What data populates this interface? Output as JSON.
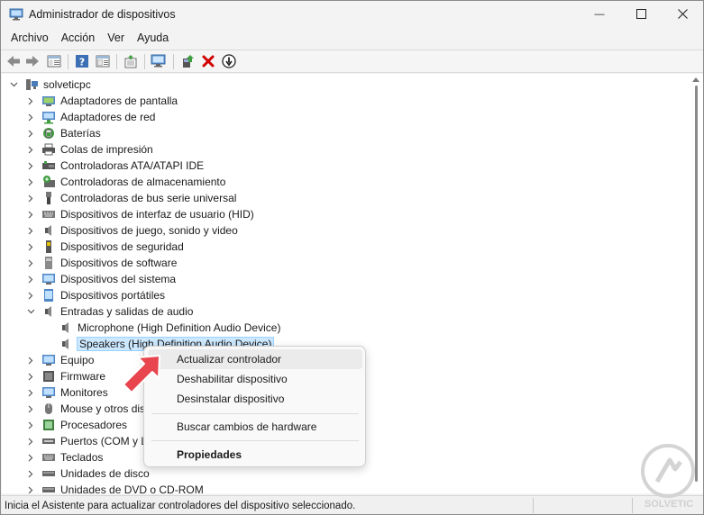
{
  "window": {
    "title": "Administrador de dispositivos",
    "minimize_glyph": "—",
    "maximize_glyph": "☐",
    "close_glyph": "✕"
  },
  "menu": [
    "Archivo",
    "Acción",
    "Ver",
    "Ayuda"
  ],
  "toolbar": {
    "buttons": [
      "back-arrow-icon",
      "forward-arrow-icon",
      "show-hide-console-tree-icon",
      "help-icon",
      "properties-icon",
      "export-list-icon",
      "monitor-scan-icon",
      "update-driver-icon",
      "uninstall-x-icon",
      "disable-device-icon"
    ]
  },
  "tree": {
    "root": "solveticpc",
    "categories": [
      "Adaptadores de pantalla",
      "Adaptadores de red",
      "Baterías",
      "Colas de impresión",
      "Controladoras ATA/ATAPI IDE",
      "Controladoras de almacenamiento",
      "Controladoras de bus serie universal",
      "Dispositivos de interfaz de usuario (HID)",
      "Dispositivos de juego, sonido y video",
      "Dispositivos de seguridad",
      "Dispositivos de software",
      "Dispositivos del sistema",
      "Dispositivos portátiles",
      "Entradas y salidas de audio"
    ],
    "audio_children": [
      "Microphone (High Definition Audio Device)",
      "Speakers (High Definition Audio Device)"
    ],
    "categories_after": [
      "Equipo",
      "Firmware",
      "Monitores",
      "Mouse y otros dis",
      "Procesadores",
      "Puertos (COM y L",
      "Teclados",
      "Unidades de disco",
      "Unidades de DVD o CD-ROM"
    ]
  },
  "context_menu": {
    "update_driver": "Actualizar controlador",
    "disable_device": "Deshabilitar dispositivo",
    "uninstall_device": "Desinstalar dispositivo",
    "scan_hardware": "Buscar cambios de hardware",
    "properties": "Propiedades"
  },
  "status_bar": {
    "text": "Inicia el Asistente para actualizar controladores del dispositivo seleccionado."
  },
  "colors": {
    "accent_selection": "#cce8ff",
    "pointer_arrow": "#e8454e",
    "uninstall_red": "#d10000"
  },
  "watermark": {
    "text": "SOLVETIC"
  }
}
